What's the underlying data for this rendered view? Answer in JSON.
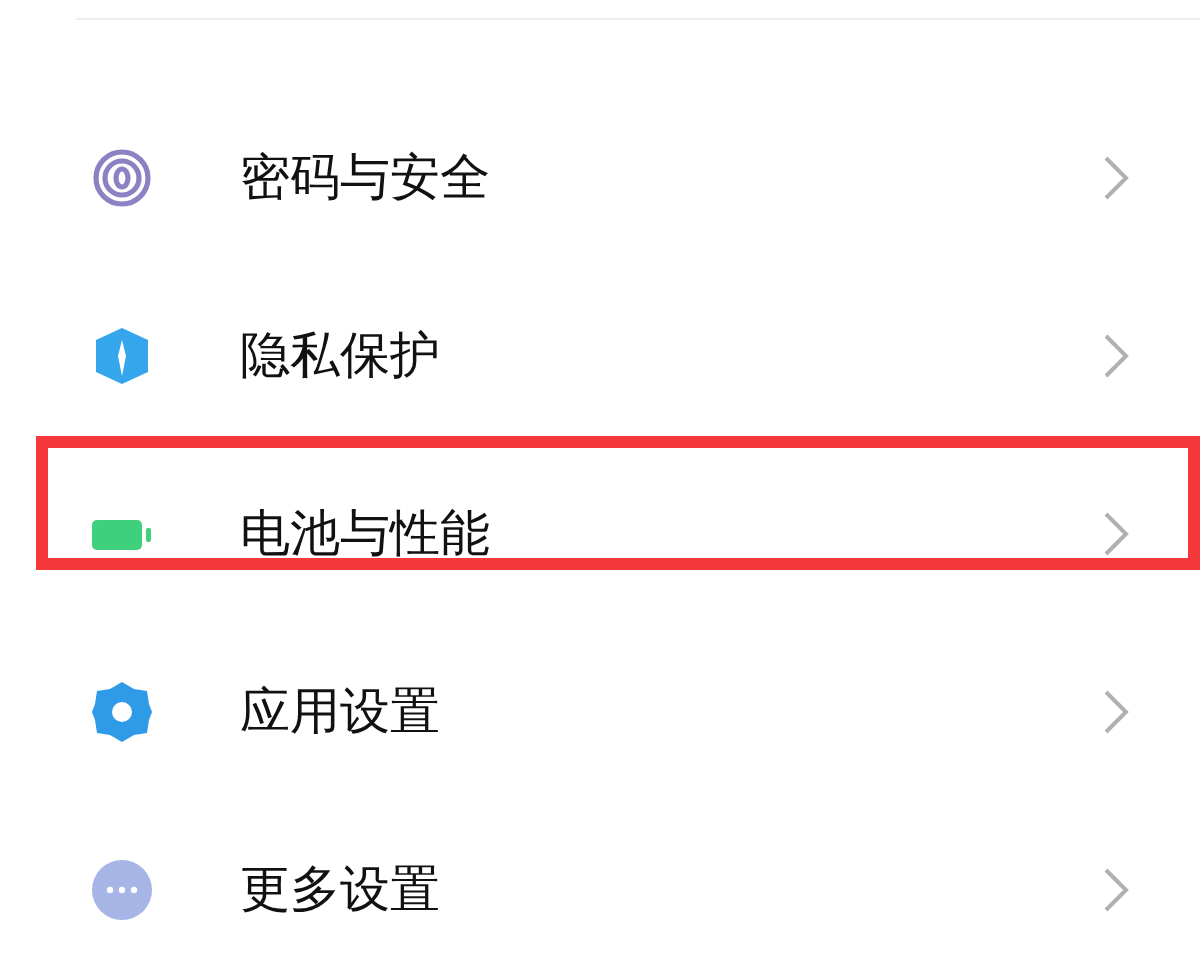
{
  "items": [
    {
      "kind": "fingerprint",
      "label": "密码与安全",
      "highlighted": false
    },
    {
      "kind": "shield",
      "label": "隐私保护",
      "highlighted": false
    },
    {
      "kind": "battery",
      "label": "电池与性能",
      "highlighted": true
    },
    {
      "kind": "gear",
      "label": "应用设置",
      "highlighted": false
    },
    {
      "kind": "more",
      "label": "更多设置",
      "highlighted": false
    }
  ]
}
